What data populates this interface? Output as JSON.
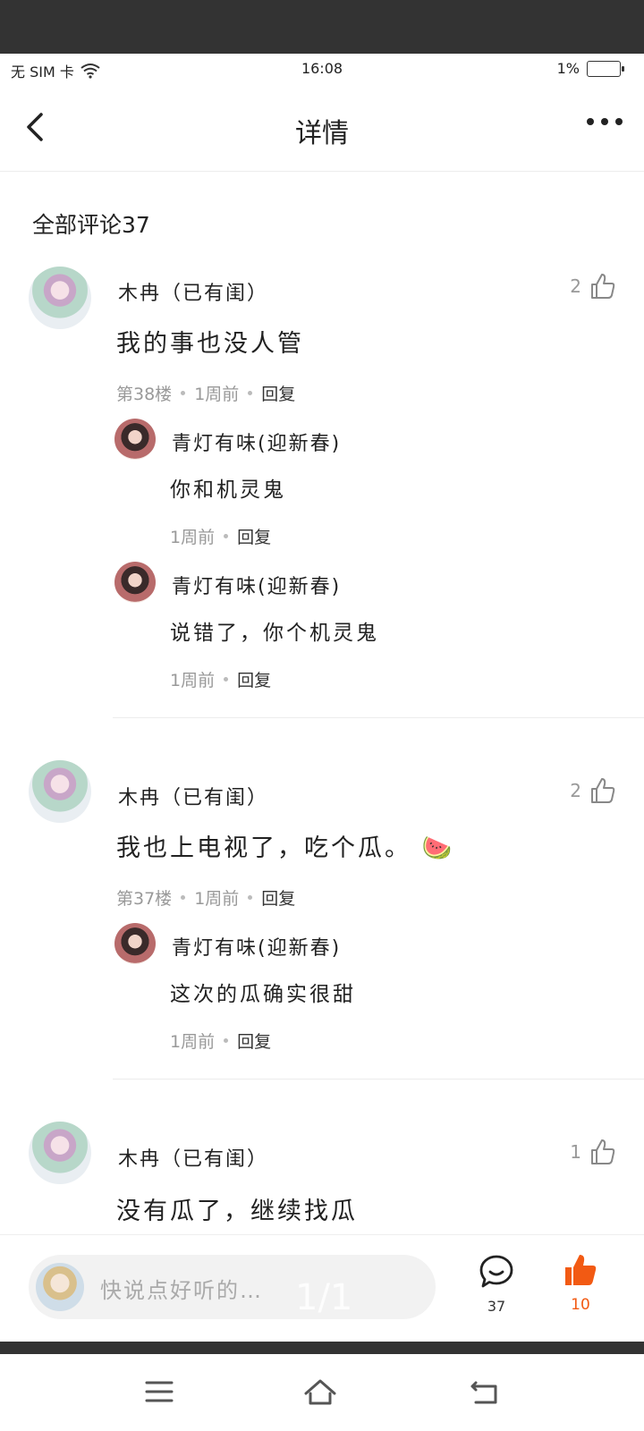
{
  "status_bar": {
    "carrier": "无 SIM 卡",
    "time": "16:08",
    "battery": "1%"
  },
  "nav": {
    "title": "详情"
  },
  "comments_section": {
    "title": "全部评论37"
  },
  "comments": [
    {
      "author": "木冉（已有闺）",
      "likes": "2",
      "text": "我的事也没人管",
      "floor": "第38楼",
      "time": "1周前",
      "reply_label": "回复",
      "replies": [
        {
          "author": "青灯有味(迎新春)",
          "text": "你和机灵鬼",
          "time": "1周前",
          "reply_label": "回复"
        },
        {
          "author": "青灯有味(迎新春)",
          "text": "说错了，你个机灵鬼",
          "time": "1周前",
          "reply_label": "回复"
        }
      ]
    },
    {
      "author": "木冉（已有闺）",
      "likes": "2",
      "text": "我也上电视了，吃个瓜。",
      "emoji": "🍉",
      "floor": "第37楼",
      "time": "1周前",
      "reply_label": "回复",
      "replies": [
        {
          "author": "青灯有味(迎新春)",
          "text": "这次的瓜确实很甜",
          "time": "1周前",
          "reply_label": "回复"
        }
      ]
    },
    {
      "author": "木冉（已有闺）",
      "likes": "1",
      "text": "没有瓜了，继续找瓜"
    }
  ],
  "bottom_bar": {
    "input_placeholder": "快说点好听的…",
    "page_indicator": "1/1",
    "comment_count": "37",
    "like_count": "10"
  },
  "colors": {
    "accent": "#f25a13",
    "topbar": "#333333"
  },
  "icons": {
    "back": "back-arrow-icon",
    "more": "more-dots-icon",
    "like": "thumbs-up-icon",
    "comment": "comment-bubble-icon",
    "menu": "menu-icon",
    "home": "home-icon",
    "return": "back-return-icon"
  }
}
